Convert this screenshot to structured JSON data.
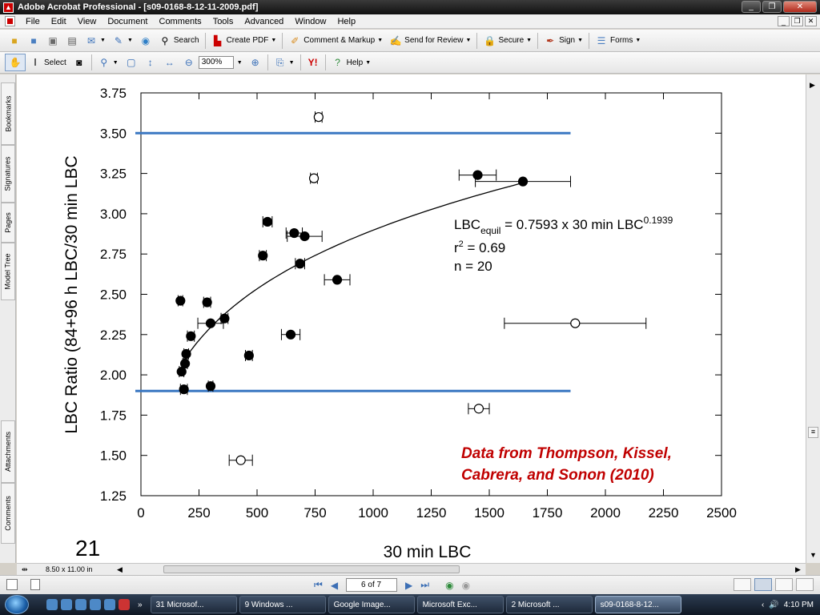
{
  "window": {
    "title": "Adobe Acrobat Professional - [s09-0168-8-12-11-2009.pdf]",
    "app_icon": "pdf-icon"
  },
  "menu": [
    "File",
    "Edit",
    "View",
    "Document",
    "Comments",
    "Tools",
    "Advanced",
    "Window",
    "Help"
  ],
  "toolbar1": {
    "search": "Search",
    "create_pdf": "Create PDF",
    "comment_markup": "Comment & Markup",
    "send_review": "Send for Review",
    "secure": "Secure",
    "sign": "Sign",
    "forms": "Forms"
  },
  "toolbar2": {
    "select": "Select",
    "zoom": "300%",
    "help": "Help"
  },
  "side_tabs": [
    "Bookmarks",
    "Signatures",
    "Pages",
    "Model Tree",
    "Attachments",
    "Comments"
  ],
  "page_size": "8.50 x 11.00 in",
  "page_nav": {
    "current": "6 of 7"
  },
  "slide": {
    "page_number": "21",
    "credit_line1": "Data from Thompson, Kissel,",
    "credit_line2": "Cabrera, and Sonon (2010)",
    "equation_main": "LBC",
    "equation_sub": "equil",
    "equation_rest": " = 0.7593 x 30 min LBC",
    "equation_exp": "0.1939",
    "r2_label": "r",
    "r2_exp": "2",
    "r2_value": " = 0.69",
    "n_value": "n = 20"
  },
  "chart_data": {
    "type": "scatter",
    "title": "",
    "xlabel": "30 min LBC",
    "ylabel": "LBC Ratio (84+96 h LBC/30 min LBC",
    "xlim": [
      0,
      2500
    ],
    "ylim": [
      1.25,
      3.75
    ],
    "x_ticks": [
      "0",
      "250",
      "500",
      "750",
      "1000",
      "1250",
      "1500",
      "1750",
      "2000",
      "2250",
      "2500"
    ],
    "y_ticks": [
      "1.25",
      "1.50",
      "1.75",
      "2.00",
      "2.25",
      "2.50",
      "2.75",
      "3.00",
      "3.25",
      "3.50",
      "3.75"
    ],
    "reference_lines": [
      {
        "y": 3.5,
        "x_from": 0,
        "x_to": 1850,
        "color": "#3b78c2"
      },
      {
        "y": 1.9,
        "x_from": 0,
        "x_to": 1850,
        "color": "#3b78c2"
      }
    ],
    "fit_curve": {
      "coef": 0.7593,
      "exponent": 0.1939,
      "x_from": 190,
      "x_to": 1650
    },
    "filled_points": [
      {
        "x": 170,
        "y": 2.46,
        "xerr": 10
      },
      {
        "x": 175,
        "y": 2.02,
        "xerr": 10
      },
      {
        "x": 190,
        "y": 2.07,
        "xerr": 10
      },
      {
        "x": 195,
        "y": 2.13,
        "xerr": 10
      },
      {
        "x": 185,
        "y": 1.91,
        "xerr": 15
      },
      {
        "x": 215,
        "y": 2.24,
        "xerr": 15
      },
      {
        "x": 285,
        "y": 2.45,
        "xerr": 15
      },
      {
        "x": 300,
        "y": 2.32,
        "xerr": 55
      },
      {
        "x": 300,
        "y": 1.93,
        "xerr": 10
      },
      {
        "x": 360,
        "y": 2.35,
        "xerr": 15
      },
      {
        "x": 465,
        "y": 2.12,
        "xerr": 15
      },
      {
        "x": 525,
        "y": 2.74,
        "xerr": 15
      },
      {
        "x": 545,
        "y": 2.95,
        "xerr": 20
      },
      {
        "x": 645,
        "y": 2.25,
        "xerr": 40
      },
      {
        "x": 660,
        "y": 2.88,
        "xerr": 35
      },
      {
        "x": 685,
        "y": 2.69,
        "xerr": 20
      },
      {
        "x": 705,
        "y": 2.86,
        "xerr": 75
      },
      {
        "x": 845,
        "y": 2.59,
        "xerr": 55
      },
      {
        "x": 1450,
        "y": 3.24,
        "xerr": 80
      },
      {
        "x": 1645,
        "y": 3.2,
        "xerr": 205
      }
    ],
    "open_points": [
      {
        "x": 765,
        "y": 3.6,
        "xerr": 15
      },
      {
        "x": 745,
        "y": 3.22,
        "xerr": 15
      },
      {
        "x": 1870,
        "y": 2.32,
        "xerr": 305
      },
      {
        "x": 1455,
        "y": 1.79,
        "xerr": 45
      },
      {
        "x": 430,
        "y": 1.47,
        "xerr": 50
      }
    ]
  },
  "taskbar": {
    "tasks": [
      "31 Microsof...",
      "9 Windows ...",
      "Google Image...",
      "Microsoft Exc...",
      "2 Microsoft ...",
      "s09-0168-8-12..."
    ],
    "clock": "4:10 PM"
  }
}
